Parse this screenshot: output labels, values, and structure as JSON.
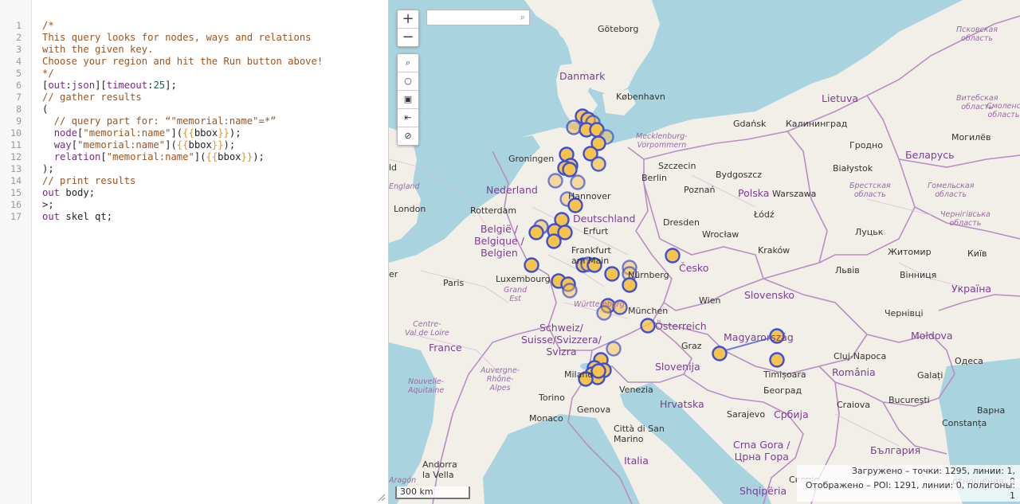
{
  "editor": {
    "lines": [
      [
        {
          "t": "/*",
          "c": "com"
        }
      ],
      [
        {
          "t": "This query looks for nodes, ways and relations",
          "c": "com"
        }
      ],
      [
        {
          "t": "with the given key.",
          "c": "com"
        }
      ],
      [
        {
          "t": "Choose your region and hit the Run button above!",
          "c": "com"
        }
      ],
      [
        {
          "t": "*/",
          "c": "com"
        }
      ],
      [
        {
          "t": "[",
          "c": "br"
        },
        {
          "t": "out",
          "c": "kw"
        },
        {
          "t": ":",
          "c": "br"
        },
        {
          "t": "json",
          "c": "kw"
        },
        {
          "t": "][",
          "c": "br"
        },
        {
          "t": "timeout",
          "c": "kw"
        },
        {
          "t": ":",
          "c": "br"
        },
        {
          "t": "25",
          "c": "num"
        },
        {
          "t": "];",
          "c": "br"
        }
      ],
      [
        {
          "t": "// gather results",
          "c": "com"
        }
      ],
      [
        {
          "t": "(",
          "c": "br"
        }
      ],
      [
        {
          "t": "  // query part for: “\"memorial:name\"=*”",
          "c": "com"
        }
      ],
      [
        {
          "t": "  ",
          "c": "plain"
        },
        {
          "t": "node",
          "c": "kw"
        },
        {
          "t": "[",
          "c": "br"
        },
        {
          "t": "\"memorial:name\"",
          "c": "str"
        },
        {
          "t": "](",
          "c": "br"
        },
        {
          "t": "{{",
          "c": "tpl"
        },
        {
          "t": "bbox",
          "c": "plain"
        },
        {
          "t": "}}",
          "c": "tpl"
        },
        {
          "t": ");",
          "c": "br"
        }
      ],
      [
        {
          "t": "  ",
          "c": "plain"
        },
        {
          "t": "way",
          "c": "kw"
        },
        {
          "t": "[",
          "c": "br"
        },
        {
          "t": "\"memorial:name\"",
          "c": "str"
        },
        {
          "t": "](",
          "c": "br"
        },
        {
          "t": "{{",
          "c": "tpl"
        },
        {
          "t": "bbox",
          "c": "plain"
        },
        {
          "t": "}}",
          "c": "tpl"
        },
        {
          "t": ");",
          "c": "br"
        }
      ],
      [
        {
          "t": "  ",
          "c": "plain"
        },
        {
          "t": "relation",
          "c": "kw"
        },
        {
          "t": "[",
          "c": "br"
        },
        {
          "t": "\"memorial:name\"",
          "c": "str"
        },
        {
          "t": "](",
          "c": "br"
        },
        {
          "t": "{{",
          "c": "tpl"
        },
        {
          "t": "bbox",
          "c": "plain"
        },
        {
          "t": "}}",
          "c": "tpl"
        },
        {
          "t": ");",
          "c": "br"
        }
      ],
      [
        {
          "t": ");",
          "c": "br"
        }
      ],
      [
        {
          "t": "// print results",
          "c": "com"
        }
      ],
      [
        {
          "t": "out",
          "c": "kw"
        },
        {
          "t": " body;",
          "c": "plain"
        }
      ],
      [
        {
          "t": ">;",
          "c": "plain"
        }
      ],
      [
        {
          "t": "out",
          "c": "kw"
        },
        {
          "t": " skel qt;",
          "c": "plain"
        }
      ]
    ]
  },
  "map": {
    "zoom_in": "+",
    "zoom_out": "−",
    "tools": [
      "⌕",
      "○",
      "▣",
      "⇤",
      "⊘"
    ],
    "search_placeholder": "",
    "scale": "300 km",
    "stats_loaded": "Загружено – точки: 1295, линии: 1, отношения: 0",
    "stats_shown": "Отображено – POI: 1291, линии: 0, полигоны: 1",
    "labels": {
      "goteborg": "Göteborg",
      "oslo_area": "",
      "danmark": "Danmark",
      "kobenhavn": "København",
      "gdansk": "Gdańsk",
      "kaliningrad": "Калининград",
      "lietuva": "Lietuva",
      "pskov": "Псковская\nобласть",
      "vitebsk": "Витебская\nобласть",
      "smolensk": "Смоленс\nобласть",
      "grodno": "Гродно",
      "mogilev": "Могилёв",
      "belarus": "Беларусь",
      "mecklenburg": "Mecklenburg-\nVorpommern",
      "groningen": "Groningen",
      "szczecin": "Szczecin",
      "bydgoszcz": "Bydgoszcz",
      "bialystok": "Białystok",
      "berlin": "Berlin",
      "poznan": "Poznań",
      "warszawa": "Warszawa",
      "brest": "Брестская\nобласть",
      "gomel": "Гомельская\nобласть",
      "nederland": "Nederland",
      "england": "England",
      "polska": "Polska",
      "hannover": "Hannover",
      "london": "London",
      "rotterdam": "Rotterdam",
      "deutschland": "Deutschland",
      "dresden": "Dresden",
      "lodz": "Łódź",
      "chernihiv": "Чернігівська\nобласть",
      "belgie": "België /\nBelgique /\nBelgien",
      "erfurt": "Erfurt",
      "wroclaw": "Wrocław",
      "lutsk": "Луцьк",
      "frankfurt": "Frankfurt\nam Main",
      "krakow": "Kraków",
      "zhytomyr": "Житомир",
      "kyiv": "Київ",
      "luxembourg": "Luxembourg",
      "cesko": "Česko",
      "lviv": "Львів",
      "vinnytsia": "Вінниця",
      "nurnberg": "Nürnberg",
      "paris": "Paris",
      "grandest": "Grand\nEst",
      "wurttemberg": "Württemberg",
      "slovensko": "Slovensko",
      "ukraina": "Україна",
      "wien": "Wien",
      "munchen": "München",
      "chernivtsi": "Чернівці",
      "schweiz": "Schweiz/\nSuisse/Svizzera/\nSvizra",
      "osterreich": "Österreich",
      "valdeloire": "Centre-\nVal de Loire",
      "magyarorszag": "Magyarország",
      "moldova": "Moldova",
      "france": "France",
      "graz": "Graz",
      "cluj": "Cluj-Napoca",
      "slovenija": "Slovenija",
      "odesa": "Одеса",
      "auvergne": "Auvergne-\nRhône-\nAlpes",
      "milano": "Milano",
      "timisoara": "Timișoara",
      "romania": "România",
      "galati": "Galați",
      "nouvelle": "Nouvelle-\nAquitaine",
      "venezia": "Venezia",
      "beograd": "Београд",
      "torino": "Torino",
      "hrvatska": "Hrvatska",
      "craiova": "Craiova",
      "bucuresti": "București",
      "monaco": "Monaco",
      "genova": "Genova",
      "sarajevo": "Sarajevo",
      "srbija": "Србија",
      "constanta": "Constanța",
      "varna": "Варна",
      "citta": "Città di San\nMarino",
      "crnagora": "Crna Gora /\nЦрна Гора",
      "bulgaria": "България",
      "andorra": "Andorra\nla Vella",
      "italia": "Italia",
      "shqiperia": "Shqipëria",
      "skopje": "Скопје",
      "aragon": "Aragón",
      "sofia": "",
      "ld": "ld",
      "er": "er"
    }
  },
  "colors": {
    "water": "#a9d3df",
    "land": "#f2efe9",
    "marker_fill": "#f7c34a",
    "marker_stroke": "#3b4fd8",
    "border": "#b98ec2"
  }
}
